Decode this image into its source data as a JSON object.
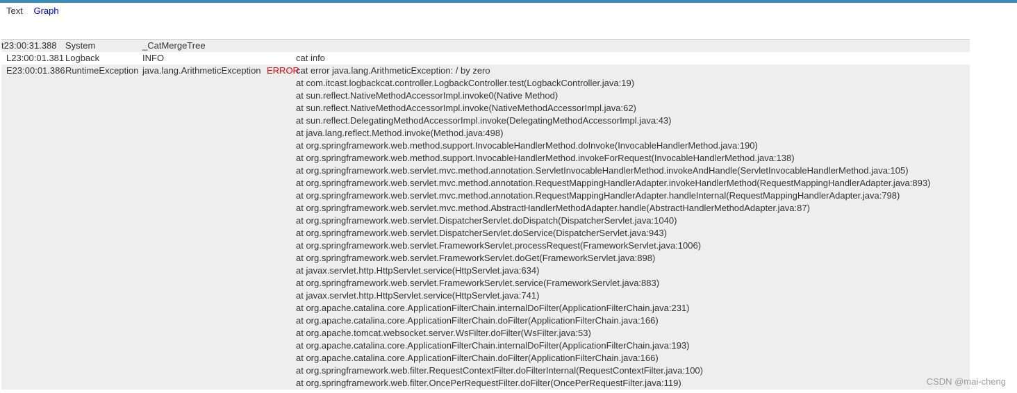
{
  "tabs": [
    {
      "label": "Text"
    },
    {
      "label": "Graph"
    }
  ],
  "rows": [
    {
      "time": "t23:00:31.388",
      "type": "System",
      "name": "_CatMergeTree",
      "status": "",
      "data": ""
    },
    {
      "time": "L23:00:01.381",
      "type": "Logback",
      "name": "INFO",
      "status": "",
      "data": "cat info"
    },
    {
      "time": "E23:00:01.386",
      "type": "RuntimeException",
      "name": "java.lang.ArithmeticException",
      "status": "ERROR",
      "data": "cat error java.lang.ArithmeticException: / by zero"
    }
  ],
  "stack": [
    "at com.itcast.logbackcat.controller.LogbackController.test(LogbackController.java:19)",
    "at sun.reflect.NativeMethodAccessorImpl.invoke0(Native Method)",
    "at sun.reflect.NativeMethodAccessorImpl.invoke(NativeMethodAccessorImpl.java:62)",
    "at sun.reflect.DelegatingMethodAccessorImpl.invoke(DelegatingMethodAccessorImpl.java:43)",
    "at java.lang.reflect.Method.invoke(Method.java:498)",
    "at org.springframework.web.method.support.InvocableHandlerMethod.doInvoke(InvocableHandlerMethod.java:190)",
    "at org.springframework.web.method.support.InvocableHandlerMethod.invokeForRequest(InvocableHandlerMethod.java:138)",
    "at org.springframework.web.servlet.mvc.method.annotation.ServletInvocableHandlerMethod.invokeAndHandle(ServletInvocableHandlerMethod.java:105)",
    "at org.springframework.web.servlet.mvc.method.annotation.RequestMappingHandlerAdapter.invokeHandlerMethod(RequestMappingHandlerAdapter.java:893)",
    "at org.springframework.web.servlet.mvc.method.annotation.RequestMappingHandlerAdapter.handleInternal(RequestMappingHandlerAdapter.java:798)",
    "at org.springframework.web.servlet.mvc.method.AbstractHandlerMethodAdapter.handle(AbstractHandlerMethodAdapter.java:87)",
    "at org.springframework.web.servlet.DispatcherServlet.doDispatch(DispatcherServlet.java:1040)",
    "at org.springframework.web.servlet.DispatcherServlet.doService(DispatcherServlet.java:943)",
    "at org.springframework.web.servlet.FrameworkServlet.processRequest(FrameworkServlet.java:1006)",
    "at org.springframework.web.servlet.FrameworkServlet.doGet(FrameworkServlet.java:898)",
    "at javax.servlet.http.HttpServlet.service(HttpServlet.java:634)",
    "at org.springframework.web.servlet.FrameworkServlet.service(FrameworkServlet.java:883)",
    "at javax.servlet.http.HttpServlet.service(HttpServlet.java:741)",
    "at org.apache.catalina.core.ApplicationFilterChain.internalDoFilter(ApplicationFilterChain.java:231)",
    "at org.apache.catalina.core.ApplicationFilterChain.doFilter(ApplicationFilterChain.java:166)",
    "at org.apache.tomcat.websocket.server.WsFilter.doFilter(WsFilter.java:53)",
    "at org.apache.catalina.core.ApplicationFilterChain.internalDoFilter(ApplicationFilterChain.java:193)",
    "at org.apache.catalina.core.ApplicationFilterChain.doFilter(ApplicationFilterChain.java:166)",
    "at org.springframework.web.filter.RequestContextFilter.doFilterInternal(RequestContextFilter.java:100)",
    "at org.springframework.web.filter.OncePerRequestFilter.doFilter(OncePerRequestFilter.java:119)"
  ],
  "watermark": "CSDN @mai-cheng",
  "colors": {
    "topbar": "#3a8bb8",
    "error": "#ff0000",
    "link": "#0000ee",
    "row_shade": "#eeeeee"
  }
}
